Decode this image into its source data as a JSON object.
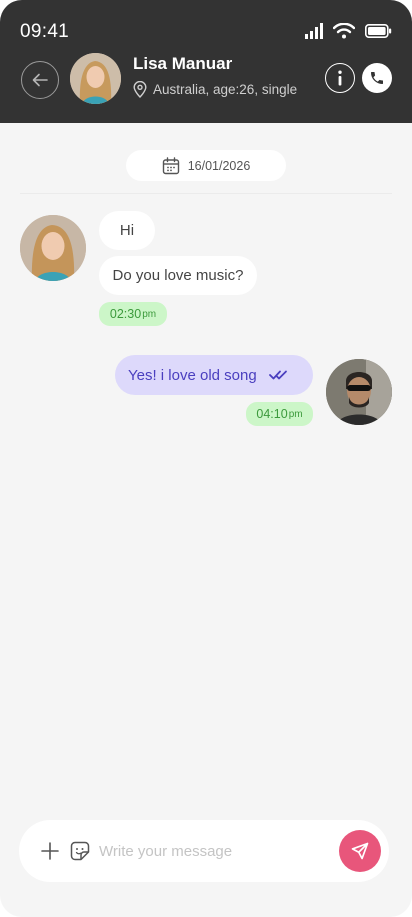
{
  "status_bar": {
    "time": "09:41"
  },
  "header": {
    "contact_name": "Lisa Manuar",
    "contact_meta": "Australia, age:26, single"
  },
  "conversation": {
    "date": "16/01/2026",
    "incoming": {
      "messages": [
        "Hi",
        "Do you love music?"
      ],
      "time": "02:30",
      "time_suffix": "pm"
    },
    "outgoing": {
      "message": "Yes! i love old song",
      "time": "04:10",
      "time_suffix": "pm"
    }
  },
  "composer": {
    "placeholder": "Write your message",
    "value": ""
  },
  "colors": {
    "header_bg": "#333333",
    "background": "#f5f5f5",
    "outgoing_bubble": "#ddd9fb",
    "outgoing_text": "#4a3fbf",
    "time_badge_bg": "#ccf6c8",
    "time_badge_text": "#3c9a3c",
    "send_button": "#e8567b"
  },
  "icons": [
    "signal-icon",
    "wifi-icon",
    "battery-icon",
    "back-arrow-icon",
    "location-pin-icon",
    "info-icon",
    "phone-icon",
    "calendar-icon",
    "double-check-icon",
    "plus-icon",
    "sticker-icon",
    "send-icon"
  ]
}
